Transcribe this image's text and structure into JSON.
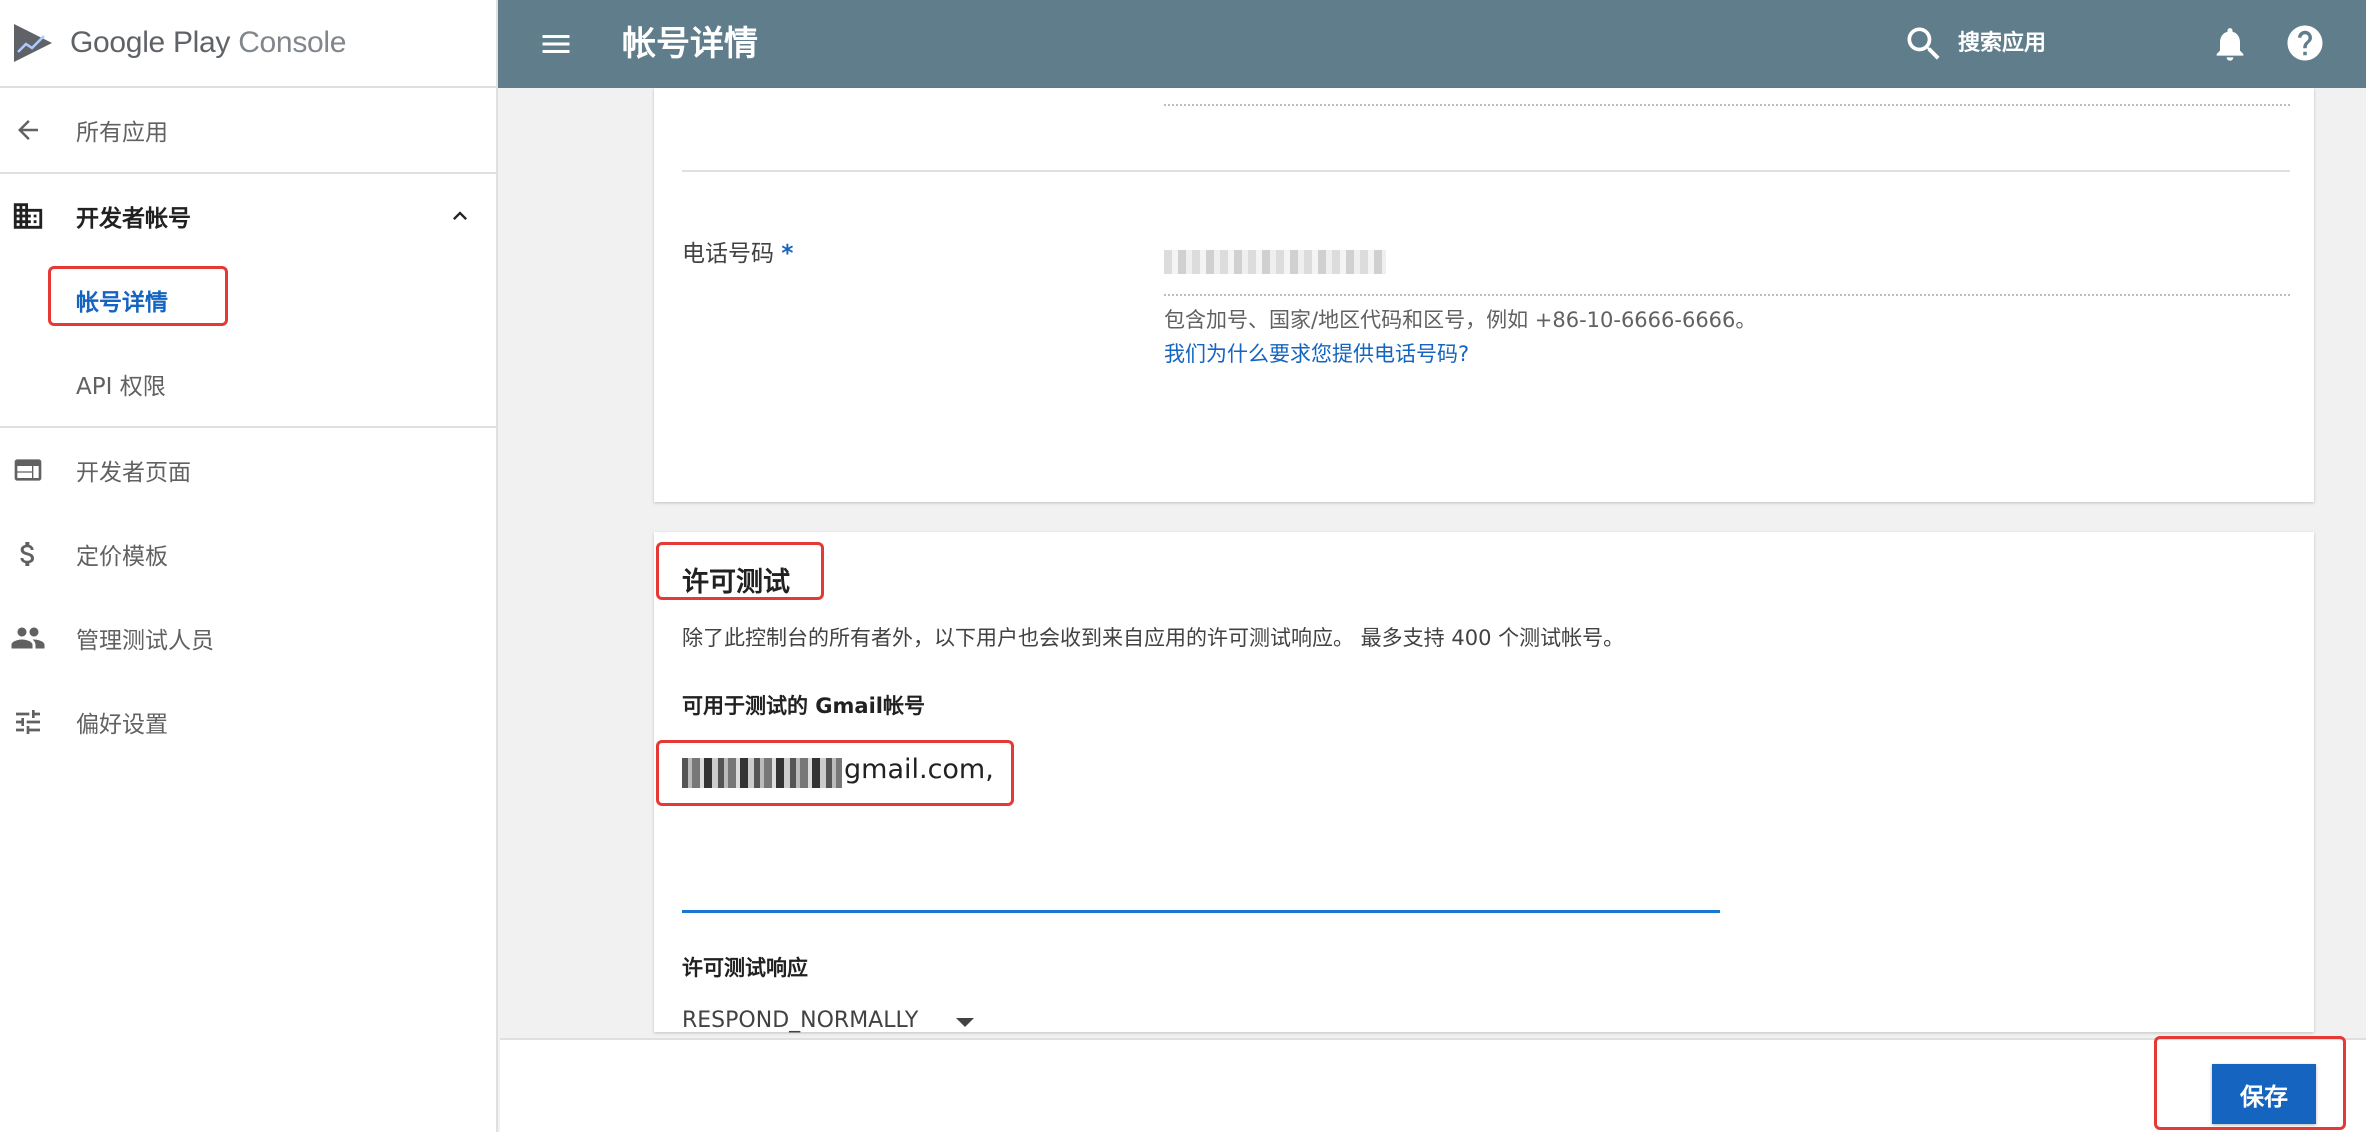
{
  "app": {
    "logo_text_1": "Google Play",
    "logo_text_2": "Console"
  },
  "header": {
    "title": "帐号详情",
    "search_label": "搜索应用"
  },
  "sidebar": {
    "items": [
      {
        "label": "所有应用",
        "icon": "arrow-back-icon"
      },
      {
        "label": "开发者帐号",
        "icon": "building-icon"
      },
      {
        "label": "帐号详情"
      },
      {
        "label": "API 权限"
      },
      {
        "label": "开发者页面",
        "icon": "web-page-icon"
      },
      {
        "label": "定价模板",
        "icon": "dollar-icon"
      },
      {
        "label": "管理测试人员",
        "icon": "people-icon"
      },
      {
        "label": "偏好设置",
        "icon": "tune-icon"
      }
    ]
  },
  "phone": {
    "label": "电话号码",
    "required_mark": "*",
    "hint": "包含加号、国家/地区代码和区号，例如 +86-10-6666-6666。",
    "why_link": "我们为什么要求您提供电话号码?"
  },
  "license_testing": {
    "title": "许可测试",
    "description": "除了此控制台的所有者外，以下用户也会收到来自应用的许可测试响应。 最多支持 400 个测试帐号。",
    "gmail_label": "可用于测试的 Gmail帐号",
    "email_suffix": "gmail.com,",
    "response_label": "许可测试响应",
    "response_value": "RESPOND_NORMALLY"
  },
  "footer": {
    "save_label": "保存"
  },
  "colors": {
    "header_bg": "#607d8b",
    "accent": "#1565c0",
    "annotation": "#e53935"
  }
}
